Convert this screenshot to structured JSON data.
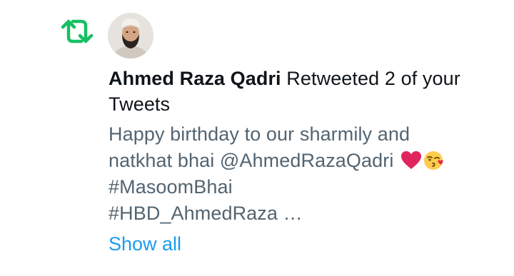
{
  "notification": {
    "actor_name": "Ahmed Raza Qadri",
    "action_text": " Retweeted 2 of your Tweets",
    "tweet_lines": [
      "Happy birthday to our sharmily and",
      "natkhat bhai @AhmedRazaQadri ",
      "#MasoomBhai",
      "#HBD_AhmedRaza …"
    ],
    "show_all_label": "Show all",
    "icons": {
      "retweet": "retweet-icon",
      "heart": "red-heart-emoji",
      "kiss": "face-blowing-kiss-emoji"
    },
    "colors": {
      "retweet_green": "#17bf63",
      "name_text": "#0f1419",
      "tweet_text": "#536471",
      "link_blue": "#1d9bf0",
      "heart_red": "#e0245e"
    }
  }
}
